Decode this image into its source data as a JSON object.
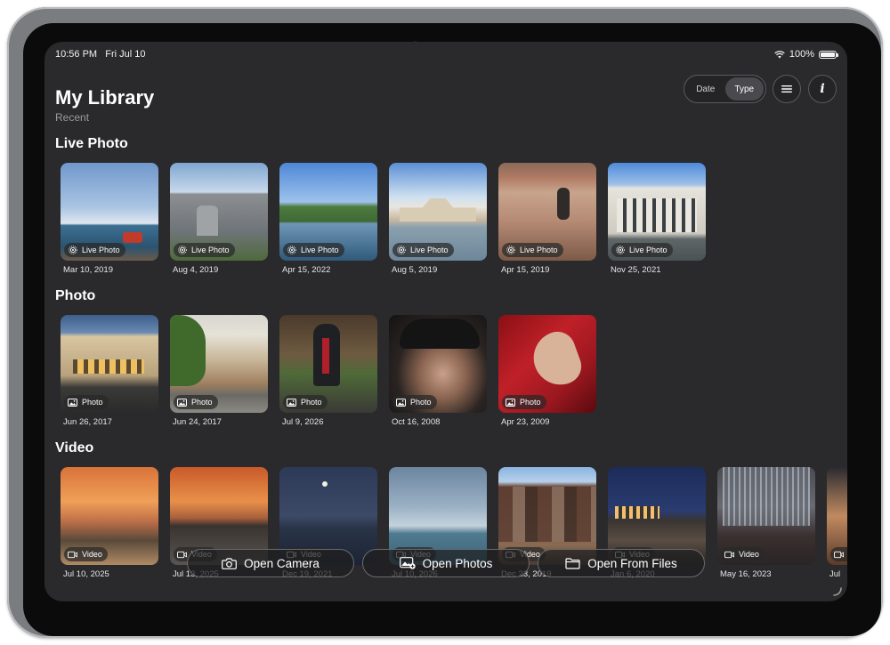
{
  "status_bar": {
    "time": "10:56 PM",
    "date": "Fri Jul 10",
    "battery": "100%"
  },
  "header": {
    "title": "My Library",
    "subtitle": "Recent",
    "sort": {
      "options": [
        "Date",
        "Type"
      ],
      "selected": "Type"
    },
    "menu_icon": "list-icon",
    "info_icon": "info-icon"
  },
  "sections": {
    "live": {
      "title": "Live Photo",
      "badge": "Live Photo",
      "items": [
        {
          "date": "Mar 10, 2019"
        },
        {
          "date": "Aug 4, 2019"
        },
        {
          "date": "Apr 15, 2022"
        },
        {
          "date": "Aug 5, 2019"
        },
        {
          "date": "Apr 15, 2019"
        },
        {
          "date": "Nov 25, 2021"
        }
      ]
    },
    "photo": {
      "title": "Photo",
      "badge": "Photo",
      "items": [
        {
          "date": "Jun 26, 2017"
        },
        {
          "date": "Jun 24, 2017"
        },
        {
          "date": "Jul 9, 2026"
        },
        {
          "date": "Oct 16, 2008"
        },
        {
          "date": "Apr 23, 2009"
        }
      ]
    },
    "video": {
      "title": "Video",
      "badge": "Video",
      "items": [
        {
          "date": "Jul 10, 2025"
        },
        {
          "date": "Jul 13, 2025"
        },
        {
          "date": "Dec 19, 2021"
        },
        {
          "date": "Jul 10, 2026"
        },
        {
          "date": "Dec 23, 2019"
        },
        {
          "date": "Jan 6, 2020"
        },
        {
          "date": "May 16, 2023"
        },
        {
          "date": "Jul"
        }
      ]
    }
  },
  "toolbar": {
    "camera": "Open Camera",
    "photos": "Open Photos",
    "files": "Open From Files"
  }
}
